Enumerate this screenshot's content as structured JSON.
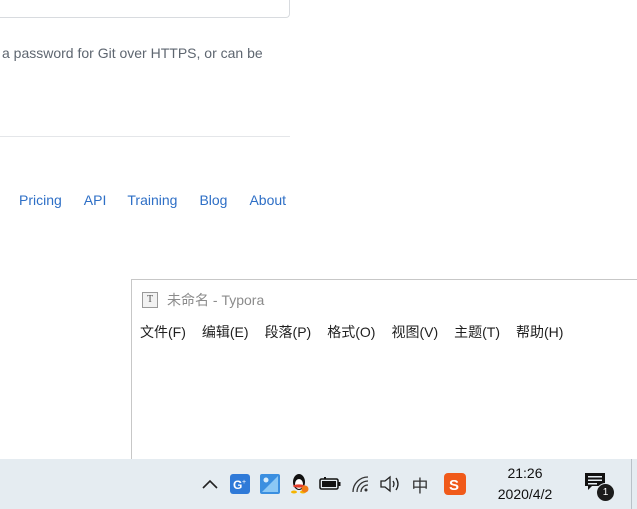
{
  "github": {
    "description_text": "a password for Git over HTTPS, or can be",
    "footer_links": [
      "Pricing",
      "API",
      "Training",
      "Blog",
      "About"
    ]
  },
  "typora": {
    "title": "未命名 - Typora",
    "app_icon_letter": "T",
    "menu": [
      "文件(F)",
      "编辑(E)",
      "段落(P)",
      "格式(O)",
      "视图(V)",
      "主题(T)",
      "帮助(H)"
    ]
  },
  "taskbar": {
    "tray_icons": [
      "chevron-up-icon",
      "g-plus-icon",
      "app-blue-icon",
      "qq-icon",
      "battery-icon",
      "wifi-icon",
      "volume-icon",
      "ime-icon",
      "sogou-icon"
    ],
    "ime_label": "中",
    "time": "21:26",
    "date": "2020/4/2",
    "notification_count": "1",
    "accent_colors": {
      "g_plus": "#2f7ad8",
      "sogou": "#f05a1a",
      "taskbar_bg": "#e5ecf1"
    }
  }
}
